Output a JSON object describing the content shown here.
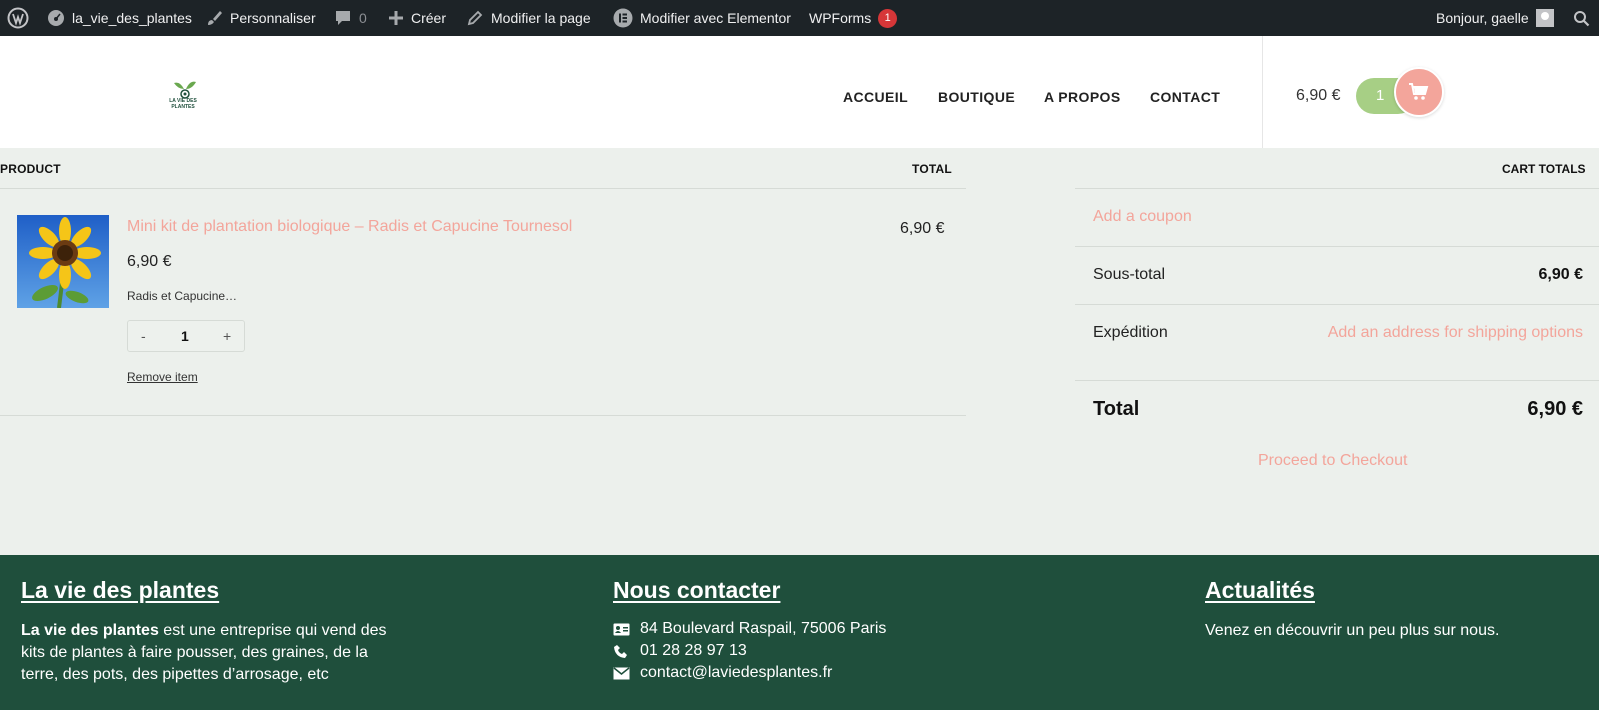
{
  "admin_bar": {
    "site_name": "la_vie_des_plantes",
    "customize": "Personnaliser",
    "comments_count": "0",
    "create": "Créer",
    "edit_page": "Modifier la page",
    "edit_elementor": "Modifier avec Elementor",
    "wpforms": "WPForms",
    "wpforms_badge": "1",
    "greeting": "Bonjour, gaelle"
  },
  "header": {
    "logo_text": "LA VIE DES PLANTES",
    "nav": [
      "ACCUEIL",
      "BOUTIQUE",
      "A PROPOS",
      "CONTACT"
    ],
    "cart_total": "6,90 €",
    "cart_count": "1"
  },
  "cart": {
    "col_product": "PRODUCT",
    "col_total": "TOTAL",
    "item": {
      "name": "Mini kit de plantation biologique – Radis et Capucine Tournesol",
      "price": "6,90 €",
      "description": "Radis et Capucine…",
      "qty_minus": "-",
      "quantity": "1",
      "qty_plus": "+",
      "remove": "Remove item",
      "line_total": "6,90 €"
    }
  },
  "totals": {
    "title": "CART TOTALS",
    "coupon": "Add a coupon",
    "subtotal_label": "Sous-total",
    "subtotal_value": "6,90 €",
    "shipping_label": "Expédition",
    "shipping_value": "Add an address for shipping options",
    "total_label": "Total",
    "total_value": "6,90 €",
    "checkout": "Proceed to Checkout"
  },
  "footer": {
    "about": {
      "title": "La vie des plantes",
      "text_bold": "La vie des plantes",
      "text_line1": " est une entreprise qui vend des",
      "text_line2": "kits de plantes à faire pousser, des graines, de la",
      "text_line3": "terre, des pots, des pipettes d’arrosage, etc"
    },
    "contact": {
      "title": "Nous contacter",
      "address": "84 Boulevard Raspail, 75006 Paris",
      "phone": "01 28 28 97 13",
      "email": "contact@laviedesplantes.fr"
    },
    "news": {
      "title": "Actualités",
      "text": "Venez en découvrir un peu plus sur nous."
    }
  },
  "colors": {
    "admin_bar": "#1d2327",
    "accent_pink": "#f3a59b",
    "accent_green": "#a7cf85",
    "footer_green": "#1f4f3c",
    "page_bg": "#ecf0ec"
  }
}
